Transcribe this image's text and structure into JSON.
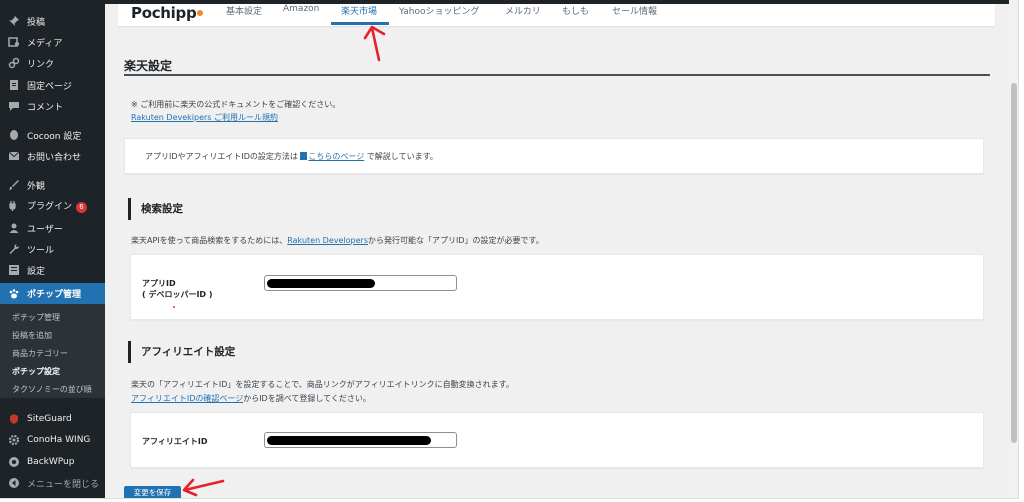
{
  "sidebar": {
    "items": [
      {
        "label": "投稿",
        "icon": "pushpin-icon"
      },
      {
        "label": "メディア",
        "icon": "media-icon"
      },
      {
        "label": "リンク",
        "icon": "link-icon"
      },
      {
        "label": "固定ページ",
        "icon": "page-icon"
      },
      {
        "label": "コメント",
        "icon": "comment-icon"
      },
      {
        "label": "Cocoon 設定",
        "icon": "cocoon-icon"
      },
      {
        "label": "お問い合わせ",
        "icon": "mail-icon"
      },
      {
        "label": "外観",
        "icon": "brush-icon"
      },
      {
        "label": "プラグイン",
        "icon": "plugin-icon",
        "badge": "6"
      },
      {
        "label": "ユーザー",
        "icon": "user-icon"
      },
      {
        "label": "ツール",
        "icon": "wrench-icon"
      },
      {
        "label": "設定",
        "icon": "settings-icon"
      },
      {
        "label": "ポチップ管理",
        "icon": "paw-icon"
      },
      {
        "label": "SiteGuard",
        "icon": "shield-icon"
      },
      {
        "label": "ConoHa WING",
        "icon": "gear-icon"
      },
      {
        "label": "BackWPup",
        "icon": "backup-icon"
      },
      {
        "label": "メニューを閉じる",
        "icon": "collapse-icon"
      }
    ],
    "submenu": [
      "ポチップ管理",
      "投稿を追加",
      "商品カテゴリー",
      "ポチップ設定",
      "タクソノミーの並び順"
    ]
  },
  "tabs": {
    "logo": "Pochipp",
    "items": [
      "基本設定",
      "Amazon",
      "楽天市場",
      "Yahooショッピング",
      "メルカリ",
      "もしも",
      "セール情報"
    ],
    "active": "楽天市場"
  },
  "main": {
    "heading": "楽天設定",
    "note": "※ ご利用前に楽天の公式ドキュメントをご確認ください。",
    "rules_link": "Rakuten Devekipers ご利用ルール規約",
    "info_prefix": "アプリIDやアフィリエイトIDの設定方法は ",
    "info_link": "こちらのページ",
    "info_suffix": " で解説しています。",
    "search_section": {
      "title": "検索設定",
      "desc_prefix": "楽天APIを使って商品検索をするためには、",
      "desc_link": "Rakuten Developers",
      "desc_suffix": "から発行可能な「アプリID」の設定が必要です。",
      "field_label_1": "アプリID",
      "field_label_2": "( デベロッパーID )"
    },
    "affiliate_section": {
      "title": "アフィリエイト設定",
      "desc_line1": "楽天の「アフィリエイトID」を設定することで、商品リンクがアフィリエイトリンクに自動変換されます。",
      "desc_link": "アフィリエイトIDの確認ページ",
      "desc_line2_suffix": "からIDを調べて登録してください。",
      "field_label": "アフィリエイトID"
    },
    "save_button": "変更を保存"
  },
  "colors": {
    "accent": "#2271b1",
    "sidebar_bg": "#1d2327",
    "annotation_arrow": "#e8202a",
    "badge": "#d63638"
  }
}
